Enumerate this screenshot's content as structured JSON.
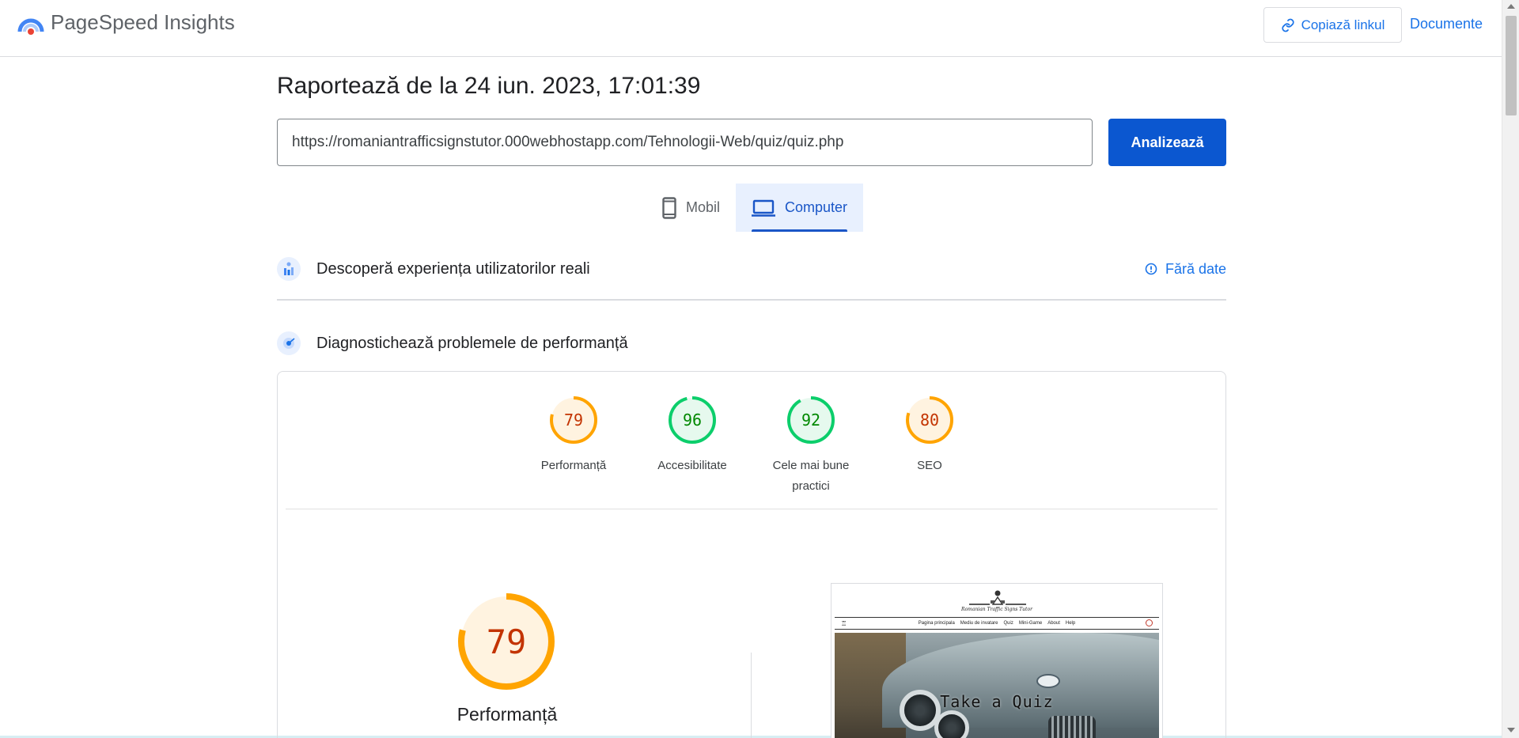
{
  "header": {
    "brand": "PageSpeed Insights",
    "copy_link_label": "Copiază linkul",
    "docs_label": "Documente"
  },
  "report": {
    "title": "Raportează de la 24 iun. 2023, 17:01:39",
    "url": "https://romaniantrafficsignstutor.000webhostapp.com/Tehnologii-Web/quiz/quiz.php",
    "analyze_label": "Analizează"
  },
  "tabs": [
    {
      "label": "Mobil",
      "icon": "smartphone-icon",
      "active": false
    },
    {
      "label": "Computer",
      "icon": "laptop-icon",
      "active": true
    }
  ],
  "field_data": {
    "title": "Descoperă experiența utilizatorilor reali",
    "status": "Fără date"
  },
  "lab_data": {
    "title": "Diagnostichează problemele de performanță"
  },
  "scores": [
    {
      "label": "Performanță",
      "value": "79",
      "rating": "average",
      "color": "#ffa400",
      "text_color": "#c33300"
    },
    {
      "label": "Accesibilitate",
      "value": "96",
      "rating": "pass",
      "color": "#0cce6b",
      "text_color": "#008800"
    },
    {
      "label": "Cele mai bune practici",
      "value": "92",
      "rating": "pass",
      "color": "#0cce6b",
      "text_color": "#008800"
    },
    {
      "label": "SEO",
      "value": "80",
      "rating": "average",
      "color": "#ffa400",
      "text_color": "#c33300"
    }
  ],
  "main_score": {
    "label": "Performanță",
    "value": "79",
    "color": "#ffa400"
  },
  "screenshot": {
    "site_title": "Romanian Traffic Signs Tutor",
    "nav": [
      "Pagina principala",
      "Mediu de invatare",
      "Quiz",
      "Mini-Game",
      "About",
      "Help"
    ],
    "hero_text": "Take a Quiz"
  }
}
